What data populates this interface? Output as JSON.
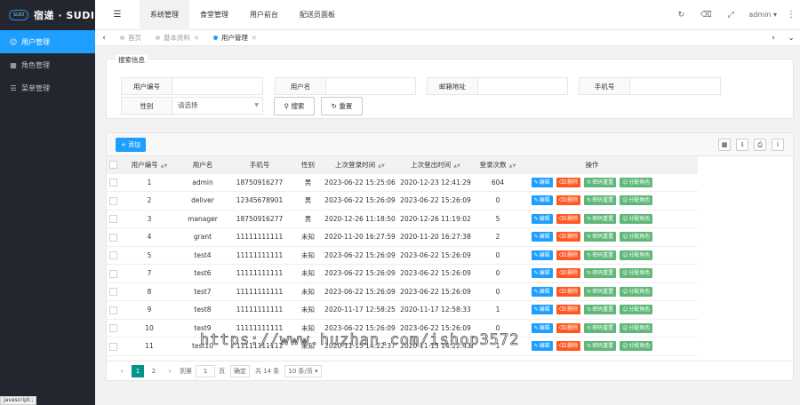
{
  "sidebar": {
    "logo_badge": "SUDI",
    "logo_text": "宿递 · SUDI",
    "items": [
      {
        "label": "用户管理",
        "icon": "user-icon",
        "active": true
      },
      {
        "label": "角色管理",
        "icon": "id-card-icon",
        "active": false
      },
      {
        "label": "菜单管理",
        "icon": "list-icon",
        "active": false
      }
    ],
    "status_tip": "javascript:;"
  },
  "header": {
    "toggle_icon": "menu-toggle-icon",
    "nav": [
      "系统管理",
      "食堂管理",
      "用户前台",
      "配送员面板"
    ],
    "active_nav": "系统管理",
    "user": "admin",
    "icons": [
      "refresh-icon",
      "clear-icon",
      "fullscreen-icon"
    ]
  },
  "tabs": [
    {
      "label": "首页",
      "active": false,
      "closable": false
    },
    {
      "label": "基本资料",
      "active": false,
      "closable": true
    },
    {
      "label": "用户管理",
      "active": true,
      "closable": true
    }
  ],
  "search": {
    "legend": "搜索信息",
    "fields": {
      "user_id": "用户编号",
      "username": "用户名",
      "email": "邮箱地址",
      "phone": "手机号",
      "gender": "性别"
    },
    "gender_placeholder": "请选择",
    "search_button": "搜索",
    "reset_button": "重置"
  },
  "toolbar": {
    "add_button": "添加"
  },
  "table": {
    "columns": [
      "用户编号",
      "用户名",
      "手机号",
      "性别",
      "上次登录时间",
      "上次登出时间",
      "登录次数",
      "操作"
    ],
    "rows": [
      [
        "1",
        "admin",
        "18750916277",
        "男",
        "2023-06-22 15:25:06",
        "2020-12-23 12:41:29",
        "604"
      ],
      [
        "2",
        "deliver",
        "12345678901",
        "男",
        "2023-06-22 15:26:09",
        "2023-06-22 15:26:09",
        "0"
      ],
      [
        "3",
        "manager",
        "18750916277",
        "男",
        "2020-12-26 11:18:50",
        "2020-12-26 11:19:02",
        "5"
      ],
      [
        "4",
        "grant",
        "11111111111",
        "未知",
        "2020-11-20 16:27:59",
        "2020-11-20 16:27:38",
        "2"
      ],
      [
        "5",
        "test4",
        "11111111111",
        "未知",
        "2023-06-22 15:26:09",
        "2023-06-22 15:26:09",
        "0"
      ],
      [
        "7",
        "test6",
        "11111111111",
        "未知",
        "2023-06-22 15:26:09",
        "2023-06-22 15:26:09",
        "0"
      ],
      [
        "8",
        "test7",
        "11111111111",
        "未知",
        "2023-06-22 15:26:09",
        "2023-06-22 15:26:09",
        "0"
      ],
      [
        "9",
        "test8",
        "11111111111",
        "未知",
        "2020-11-17 12:58:25",
        "2020-11-17 12:58:33",
        "1"
      ],
      [
        "10",
        "test9",
        "11111111111",
        "未知",
        "2023-06-22 15:26:09",
        "2023-06-22 15:26:09",
        "0"
      ],
      [
        "11",
        "test10",
        "11111111111",
        "未知",
        "2020-11-15 14:22:37",
        "2020-11-15 14:22:43",
        "1"
      ]
    ],
    "actions": {
      "edit": "编辑",
      "delete": "删除",
      "reset_pwd": "密码重置",
      "assign_role": "分配角色"
    }
  },
  "pager": {
    "pages": [
      "1",
      "2"
    ],
    "current": "1",
    "goto_label": "到第",
    "goto_value": "1",
    "page_unit": "页",
    "confirm": "确定",
    "total": "共 14 条",
    "page_size": "10 条/页"
  },
  "watermark": "https://www.huzhan.com/ishop3572",
  "colors": {
    "primary": "#1e9fff",
    "danger": "#ff5722",
    "success": "#5fb878",
    "pager_active": "#009688",
    "sidebar_bg": "#23262e"
  }
}
